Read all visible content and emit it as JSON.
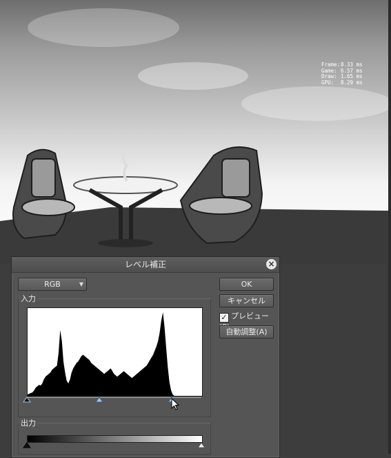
{
  "perf_overlay": [
    {
      "label": "Frame:",
      "value": "8.33 ms"
    },
    {
      "label": "Game:",
      "value": "6.57 ms"
    },
    {
      "label": "Draw:",
      "value": "1.65 ms"
    },
    {
      "label": "GPU:",
      "value": "8.29 ms"
    }
  ],
  "dialog": {
    "title": "レベル補正",
    "close_symbol": "×",
    "channel_select": "RGB",
    "ok_label": "OK",
    "cancel_label": "キャンセル",
    "preview_label": "プレビュー(P)",
    "preview_checked": true,
    "auto_label": "自動調整(A)",
    "input_group_label": "入力",
    "output_group_label": "出力"
  },
  "levels": {
    "input_black": 0,
    "input_gamma": 1.0,
    "input_white": 0.83,
    "output_black": 0,
    "output_white": 1
  },
  "histogram": [
    2,
    3,
    4,
    5,
    8,
    12,
    14,
    16,
    15,
    18,
    24,
    28,
    30,
    32,
    34,
    38,
    40,
    42,
    44,
    62,
    96,
    80,
    50,
    34,
    22,
    18,
    24,
    34,
    40,
    44,
    48,
    50,
    54,
    58,
    60,
    58,
    56,
    54,
    52,
    48,
    46,
    44,
    42,
    40,
    38,
    36,
    34,
    32,
    34,
    36,
    38,
    40,
    36,
    32,
    30,
    28,
    30,
    32,
    34,
    36,
    34,
    32,
    30,
    28,
    26,
    28,
    30,
    32,
    34,
    36,
    38,
    40,
    42,
    44,
    48,
    52,
    56,
    60,
    66,
    72,
    80,
    92,
    110,
    122,
    100,
    70,
    42,
    20,
    8,
    2,
    0,
    0,
    0,
    0,
    0,
    0,
    0,
    0,
    0,
    0,
    0,
    0,
    0,
    0,
    0,
    0,
    0,
    0
  ],
  "colors": {
    "histogram_fill": "#000000",
    "handle_input": "#9ec8e8",
    "handle_output_black": "#111111",
    "handle_output_white": "#f0f0f0"
  }
}
